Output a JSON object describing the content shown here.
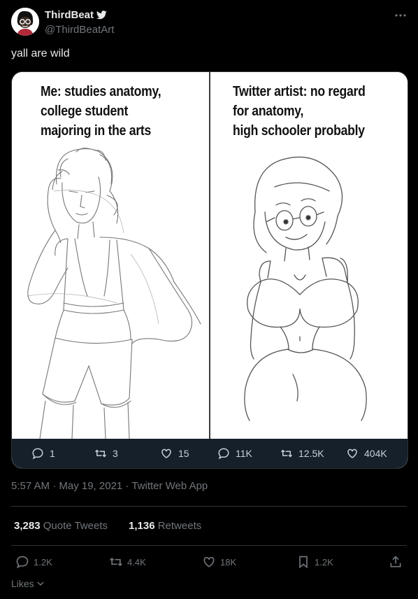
{
  "author": {
    "display_name": "ThirdBeat",
    "handle": "@ThirdBeatArt",
    "avatar_icon": "cartoon-avatar-icon",
    "verified_icon": "twitter-bird-icon"
  },
  "tweet": {
    "text": "yall are wild",
    "timestamp": "5:57 AM · May 19, 2021 · Twitter Web App"
  },
  "media": {
    "left_panel": {
      "caption": [
        "Me: studies anatomy,",
        "college student",
        "majoring in the arts"
      ],
      "stats": {
        "replies": "1",
        "retweets": "3",
        "likes": "15"
      }
    },
    "right_panel": {
      "caption": [
        "Twitter artist: no regard",
        "for anatomy,",
        "high schooler probably"
      ],
      "stats": {
        "replies": "11K",
        "retweets": "12.5K",
        "likes": "404K"
      }
    },
    "stats_bar_color": "#15202b"
  },
  "engagement": {
    "quote_tweets_count": "3,283",
    "quote_tweets_label": "Quote Tweets",
    "retweets_count": "1,136",
    "retweets_label": "Retweets"
  },
  "actions": {
    "reply": "1.2K",
    "retweet": "4.4K",
    "like": "18K",
    "bookmark": "1.2K"
  },
  "likes_dropdown_label": "Likes",
  "colors": {
    "background": "#000000",
    "text_primary": "#e7e9ea",
    "text_secondary": "#71767b",
    "border": "#2f3336"
  }
}
